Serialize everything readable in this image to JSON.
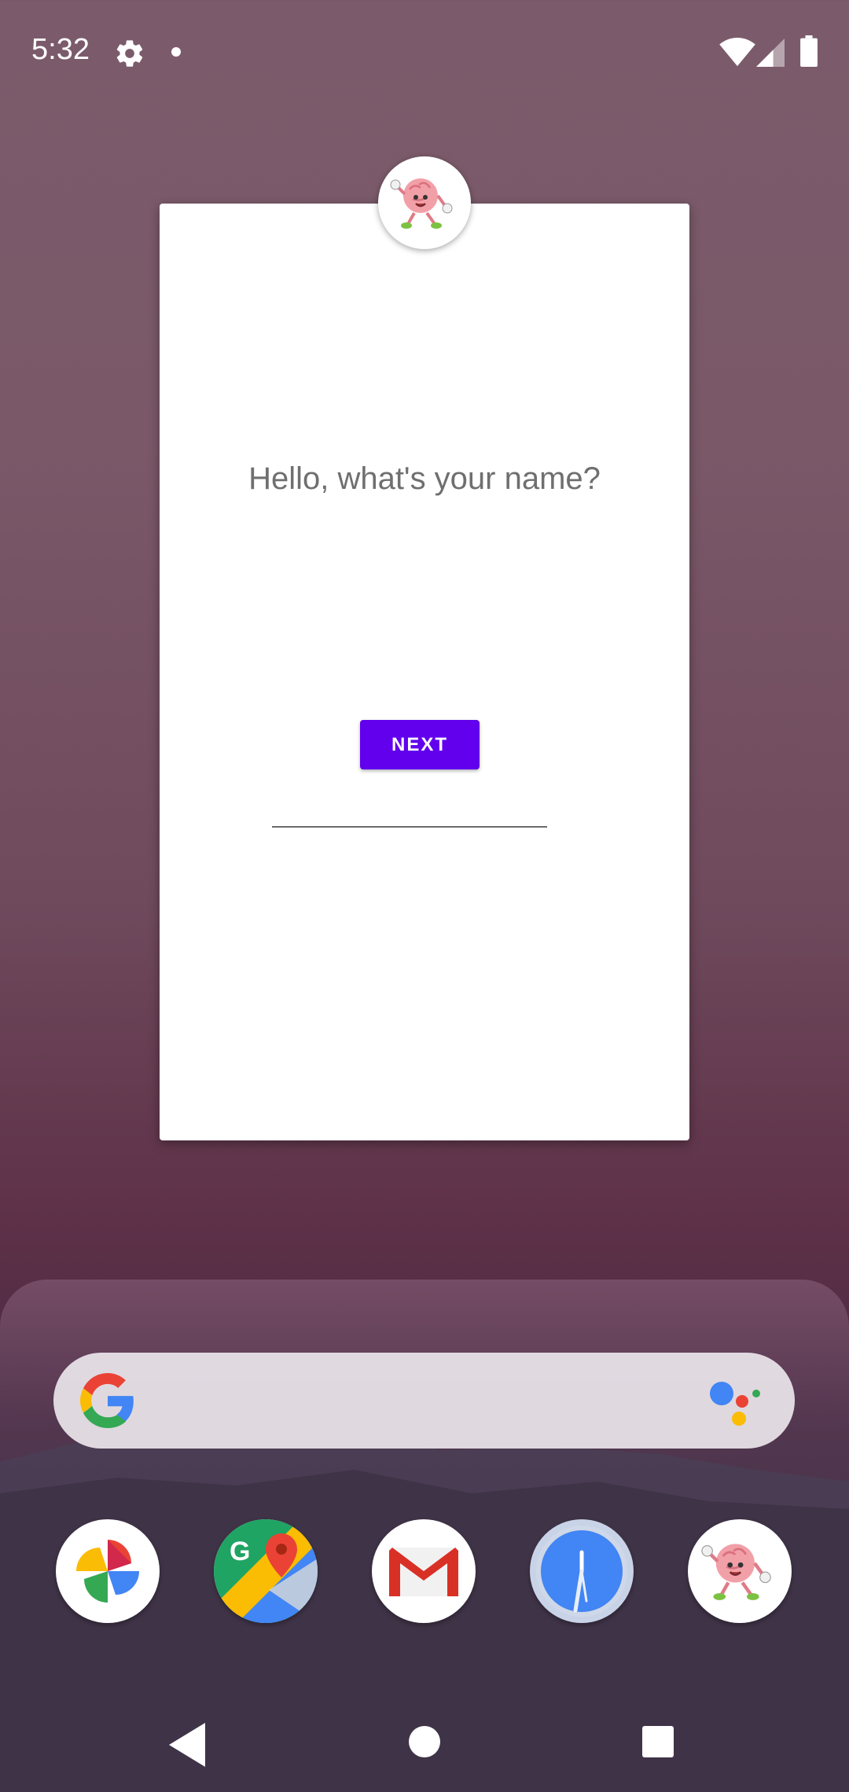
{
  "status_bar": {
    "time": "5:32",
    "icons": [
      "gear-icon",
      "notification-dot-icon",
      "wifi-icon",
      "signal-icon",
      "battery-icon"
    ]
  },
  "card": {
    "avatar_icon": "brain-mascot-icon",
    "question": "Hello, what's your name?",
    "name_input": {
      "value": "",
      "placeholder": ""
    },
    "next_button_label": "NEXT",
    "accent_color": "#6200ee"
  },
  "search_bar": {
    "icons": [
      "google-g-icon",
      "google-assistant-icon"
    ]
  },
  "dock": {
    "apps": [
      {
        "name": "Google Photos",
        "icon": "photos-pinwheel-icon"
      },
      {
        "name": "Maps",
        "icon": "maps-icon"
      },
      {
        "name": "Gmail",
        "icon": "gmail-icon"
      },
      {
        "name": "Clock",
        "icon": "clock-icon"
      },
      {
        "name": "Brain app",
        "icon": "brain-mascot-icon"
      }
    ]
  },
  "nav_bar": {
    "icons": [
      "back-icon",
      "home-icon",
      "recents-icon"
    ]
  }
}
